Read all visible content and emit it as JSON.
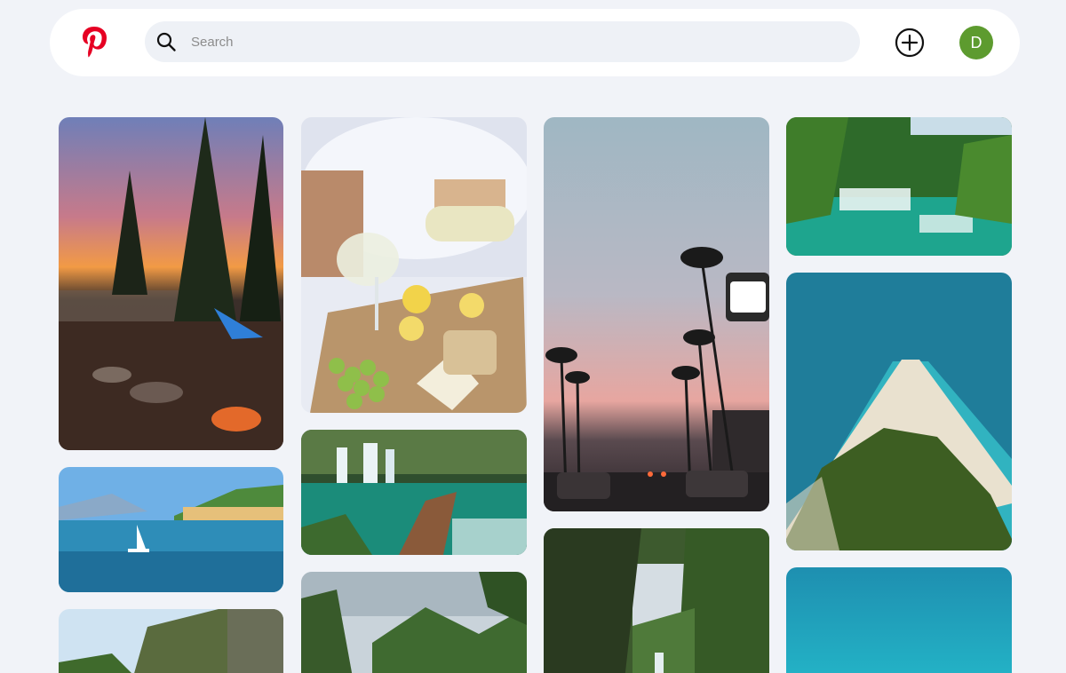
{
  "header": {
    "logo_icon": "pinterest-logo-icon",
    "search_placeholder": "Search",
    "search_value": "",
    "search_icon": "search-icon",
    "create_icon": "plus-circle-icon",
    "avatar_initial": "D",
    "colors": {
      "brand": "#e60023",
      "avatar": "#5d9b2f",
      "search_bg": "#eef1f6",
      "page_bg": "#f1f3f8"
    }
  },
  "pins": [
    {
      "subject": "sunset-campsite-lake"
    },
    {
      "subject": "wine-cheese-picnic"
    },
    {
      "subject": "palm-tree-street-sunset"
    },
    {
      "subject": "waterfalls-forest"
    },
    {
      "subject": "turquoise-beach-spit-aerial"
    },
    {
      "subject": "lake-village-sailboat"
    },
    {
      "subject": "boardwalk-waterfalls"
    },
    {
      "subject": "jungle-canopy"
    },
    {
      "subject": "cliff-greenery"
    },
    {
      "subject": "tropical-trees-sky"
    },
    {
      "subject": "turquoise-sea"
    }
  ]
}
